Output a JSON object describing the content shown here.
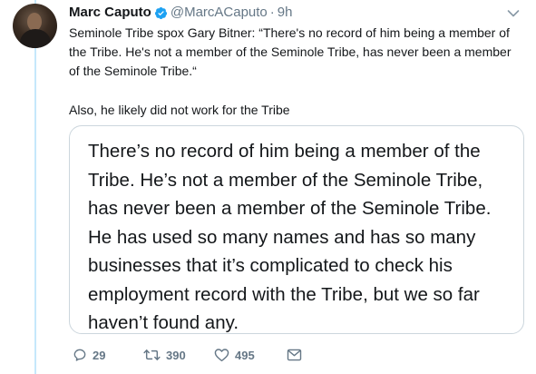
{
  "tweet": {
    "author": {
      "display_name": "Marc Caputo",
      "handle": "@MarcACaputo",
      "separator": "·",
      "time": "9h",
      "verified": true
    },
    "text_line1": "Seminole Tribe spox Gary Bitner: “There's no record of him being a member of the Tribe. He's not a member of the Seminole Tribe, has never been a member of the Seminole Tribe.“",
    "text_line2": "Also, he likely did not work for the Tribe",
    "quote_text": "There’s no record of him being a member of the Tribe. He’s not a member of the Seminole Tribe, has never been a member of the Seminole Tribe. He has used so many names and has so many businesses that it’s complicated to check his employment record with the Tribe, but we so far haven’t found any.",
    "actions": {
      "replies": "29",
      "retweets": "390",
      "likes": "495"
    }
  },
  "colors": {
    "verified_blue": "#1da1f2",
    "muted_text": "#657786",
    "thread_line": "#c6e8fb",
    "card_border": "#ccd6dd"
  },
  "icons": {
    "verified": "verified-badge-icon",
    "menu": "chevron-down-icon",
    "reply": "reply-icon",
    "retweet": "retweet-icon",
    "like": "heart-icon",
    "dm": "envelope-icon"
  }
}
